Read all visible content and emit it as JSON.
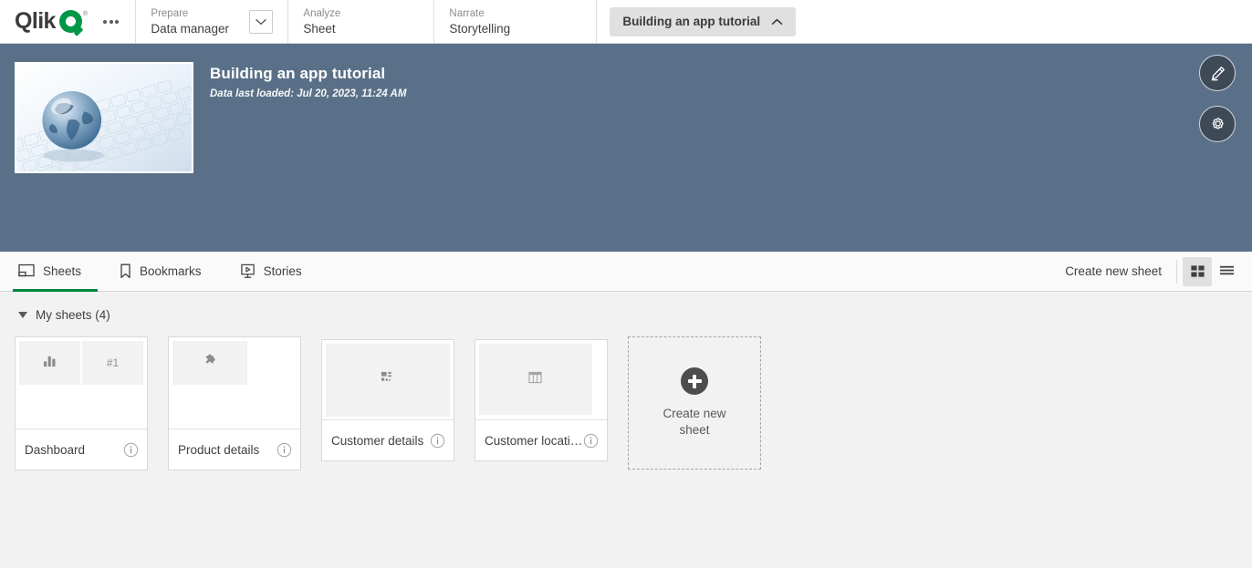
{
  "topbar": {
    "logo_text": "Qlik",
    "logo_tm": "®",
    "overflow_menu": "more-options",
    "sections": [
      {
        "kicker": "Prepare",
        "value": "Data manager",
        "has_dropdown": true
      },
      {
        "kicker": "Analyze",
        "value": "Sheet",
        "has_dropdown": false
      },
      {
        "kicker": "Narrate",
        "value": "Storytelling",
        "has_dropdown": false
      }
    ],
    "app_pill_label": "Building an app tutorial"
  },
  "banner": {
    "title": "Building an app tutorial",
    "subtitle": "Data last loaded: Jul 20, 2023, 11:24 AM",
    "thumbnail_alt": "glass globe on a white keyboard",
    "background_color": "#5a7088",
    "actions": [
      {
        "name": "edit-app-button",
        "icon": "pencil-icon"
      },
      {
        "name": "app-settings-button",
        "icon": "gear-icon"
      }
    ]
  },
  "tabs": [
    {
      "label": "Sheets",
      "icon": "sheet-icon",
      "active": true
    },
    {
      "label": "Bookmarks",
      "icon": "bookmark-icon",
      "active": false
    },
    {
      "label": "Stories",
      "icon": "story-icon",
      "active": false
    }
  ],
  "tabbar_right": {
    "create_new_sheet": "Create new sheet",
    "grid_view": "grid-view-icon",
    "list_view": "list-view-icon",
    "active_view": "grid"
  },
  "sheets_section": {
    "heading": "My sheets (4)",
    "expanded": true,
    "sheets": [
      {
        "title": "Dashboard",
        "layout": "dashboard",
        "tiles": [
          {
            "icon": "bar-chart-icon"
          },
          {
            "label": "#1"
          }
        ]
      },
      {
        "title": "Product details",
        "layout": "product",
        "tiles": [
          {
            "icon": "puzzle-icon"
          }
        ]
      },
      {
        "title": "Customer details",
        "layout": "full",
        "tiles": [
          {
            "icon": "filter-pane-icon"
          }
        ]
      },
      {
        "title": "Customer location",
        "layout": "loc",
        "tiles": [
          {
            "icon": "table-icon"
          }
        ]
      }
    ],
    "create_card": {
      "label": "Create new\nsheet",
      "line1": "Create new",
      "line2": "sheet",
      "icon": "plus-icon"
    }
  },
  "colors": {
    "accent_green": "#00873d",
    "banner": "#5a7088",
    "page_bg": "#f2f2f2",
    "tile_bg": "#f2f2f2"
  }
}
